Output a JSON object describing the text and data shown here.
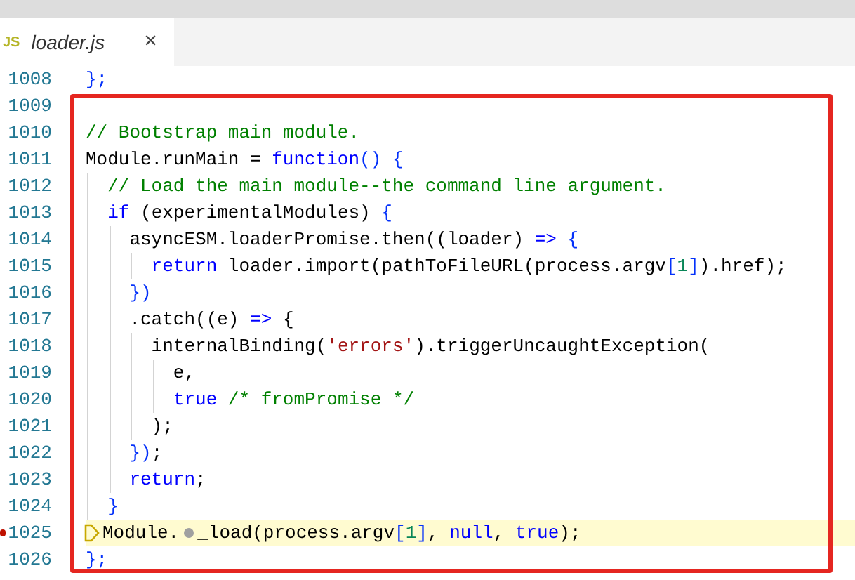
{
  "tab": {
    "icon_text": "JS",
    "label": "loader.js",
    "close": "×",
    "selected": true
  },
  "lines": [
    {
      "number": "1008",
      "current": false,
      "tokens": [
        {
          "kind": "bracket",
          "text": "};"
        }
      ]
    },
    {
      "number": "1009",
      "current": false
    },
    {
      "number": "1010",
      "current": false,
      "tokens": [
        {
          "kind": "comment",
          "text": "// Bootstrap main module."
        }
      ]
    },
    {
      "number": "1011",
      "current": false,
      "tokens": [
        {
          "kind": "plain",
          "text": "Module.runMain = "
        },
        {
          "kind": "keyword",
          "text": "function"
        },
        {
          "kind": "bracket",
          "text": "() {"
        }
      ]
    },
    {
      "number": "1012",
      "current": false,
      "tokens": [
        {
          "kind": "comment",
          "text": "  // Load the main module--the command line argument."
        }
      ]
    },
    {
      "number": "1013",
      "current": false,
      "tokens": [
        {
          "kind": "keyword",
          "text": "  if"
        },
        {
          "kind": "plain",
          "text": " (experimentalModules) "
        },
        {
          "kind": "bracket",
          "text": "{"
        }
      ]
    },
    {
      "number": "1014",
      "current": false,
      "tokens": [
        {
          "kind": "plain",
          "text": "    asyncESM.loaderPromise.then((loader) "
        },
        {
          "kind": "keyword",
          "text": "=>"
        },
        {
          "kind": "bracket",
          "text": " {"
        }
      ]
    },
    {
      "number": "1015",
      "current": false,
      "tokens": [
        {
          "kind": "keyword",
          "text": "      return"
        },
        {
          "kind": "plain",
          "text": " loader.import(pathToFileURL(process.argv"
        },
        {
          "kind": "bracket",
          "text": "["
        },
        {
          "kind": "number",
          "text": "1"
        },
        {
          "kind": "bracket",
          "text": "]"
        },
        {
          "kind": "plain",
          "text": ").href);"
        }
      ]
    },
    {
      "number": "1016",
      "current": false,
      "tokens": [
        {
          "kind": "bracket",
          "text": "    })"
        }
      ]
    },
    {
      "number": "1017",
      "current": false,
      "tokens": [
        {
          "kind": "plain",
          "text": "    .catch((e) "
        },
        {
          "kind": "keyword",
          "text": "=>"
        },
        {
          "kind": "plain",
          "text": " {"
        }
      ]
    },
    {
      "number": "1018",
      "current": false,
      "tokens": [
        {
          "kind": "plain",
          "text": "      internalBinding("
        },
        {
          "kind": "string",
          "text": "'errors'"
        },
        {
          "kind": "plain",
          "text": ").triggerUncaughtException("
        }
      ]
    },
    {
      "number": "1019",
      "current": false,
      "tokens": [
        {
          "kind": "plain",
          "text": "        e,"
        }
      ]
    },
    {
      "number": "1020",
      "current": false,
      "tokens": [
        {
          "kind": "keyword",
          "text": "        true"
        },
        {
          "kind": "comment",
          "text": " /* fromPromise */"
        }
      ]
    },
    {
      "number": "1021",
      "current": false,
      "tokens": [
        {
          "kind": "plain",
          "text": "      );"
        }
      ]
    },
    {
      "number": "1022",
      "current": false,
      "tokens": [
        {
          "kind": "bracket",
          "text": "    })"
        },
        {
          "kind": "plain",
          "text": ";"
        }
      ]
    },
    {
      "number": "1023",
      "current": false,
      "tokens": [
        {
          "kind": "keyword",
          "text": "    return"
        },
        {
          "kind": "plain",
          "text": ";"
        }
      ]
    },
    {
      "number": "1024",
      "current": false,
      "tokens": [
        {
          "kind": "bracket",
          "text": "  }"
        }
      ]
    },
    {
      "number": "1025",
      "current": true,
      "tokens": [
        {
          "kind": "plain",
          "text": "Module."
        },
        {
          "kind": "inline-breakpoint"
        },
        {
          "kind": "plain",
          "text": "_load(process.argv"
        },
        {
          "kind": "bracket",
          "text": "["
        },
        {
          "kind": "number",
          "text": "1"
        },
        {
          "kind": "bracket",
          "text": "]"
        },
        {
          "kind": "plain",
          "text": ", "
        },
        {
          "kind": "keyword",
          "text": "null"
        },
        {
          "kind": "plain",
          "text": ", "
        },
        {
          "kind": "keyword",
          "text": "true"
        },
        {
          "kind": "plain",
          "text": ");"
        }
      ]
    },
    {
      "number": "1026",
      "current": false,
      "tokens": [
        {
          "kind": "bracket",
          "text": "};"
        }
      ]
    }
  ]
}
